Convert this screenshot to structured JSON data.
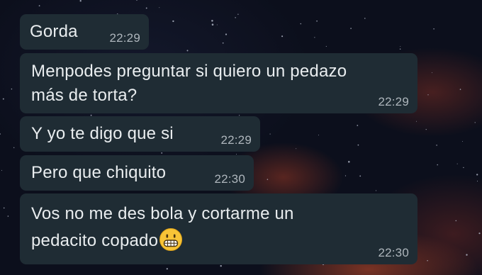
{
  "messages": [
    {
      "text": "Gorda",
      "time": "22:29"
    },
    {
      "text": "Menpodes preguntar si quiero un pedazo\nmás de torta?",
      "time": "22:29"
    },
    {
      "text": "Y yo te digo que si",
      "time": "22:29"
    },
    {
      "text": "Pero que chiquito",
      "time": "22:30"
    },
    {
      "text": "Vos no me des bola y cortarme un\npedacito copado",
      "time": "22:30",
      "emoji": "grimacing-face"
    }
  ],
  "colors": {
    "bubble": "#1f2c34",
    "text": "#e9edef",
    "timestamp": "#aeb6bc"
  }
}
